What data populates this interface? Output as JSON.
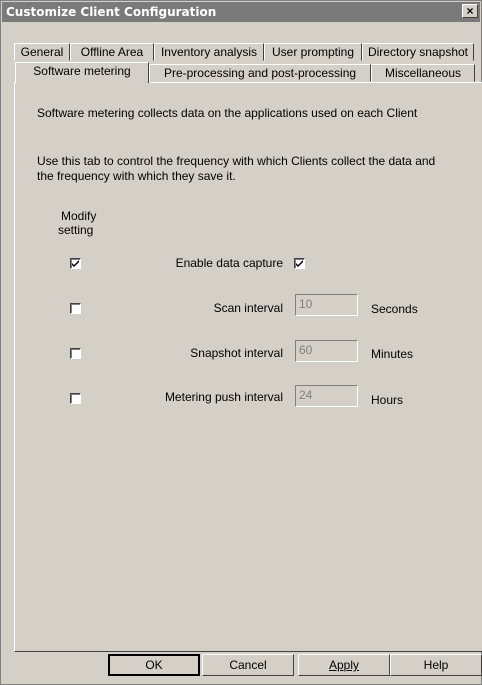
{
  "window": {
    "title": "Customize Client Configuration",
    "close_label": "×"
  },
  "tabs_row1": [
    {
      "label": "General"
    },
    {
      "label": "Offline Area"
    },
    {
      "label": "Inventory analysis"
    },
    {
      "label": "User prompting"
    },
    {
      "label": "Directory snapshot"
    }
  ],
  "tabs_row2": [
    {
      "label": "Software metering",
      "active": true
    },
    {
      "label": "Pre-processing and post-processing"
    },
    {
      "label": "Miscellaneous"
    }
  ],
  "panel": {
    "description": "Software metering collects data on the applications used on each Client",
    "instructions_line1": "Use this tab to control the frequency with which Clients collect the data and",
    "instructions_line2": "the frequency with which they save it.",
    "modify_header_line1": "Modify",
    "modify_header_line2": "setting"
  },
  "settings": [
    {
      "label": "Enable data capture",
      "modify_checked": true,
      "value_checked": true
    },
    {
      "label": "Scan interval",
      "value": "10",
      "unit": "Seconds",
      "modify_checked": false
    },
    {
      "label": "Snapshot interval",
      "value": "60",
      "unit": "Minutes",
      "modify_checked": false
    },
    {
      "label": "Metering push interval",
      "value": "24",
      "unit": "Hours",
      "modify_checked": false
    }
  ],
  "buttons": {
    "ok": "OK",
    "cancel": "Cancel",
    "apply": "Apply",
    "help": "Help"
  }
}
